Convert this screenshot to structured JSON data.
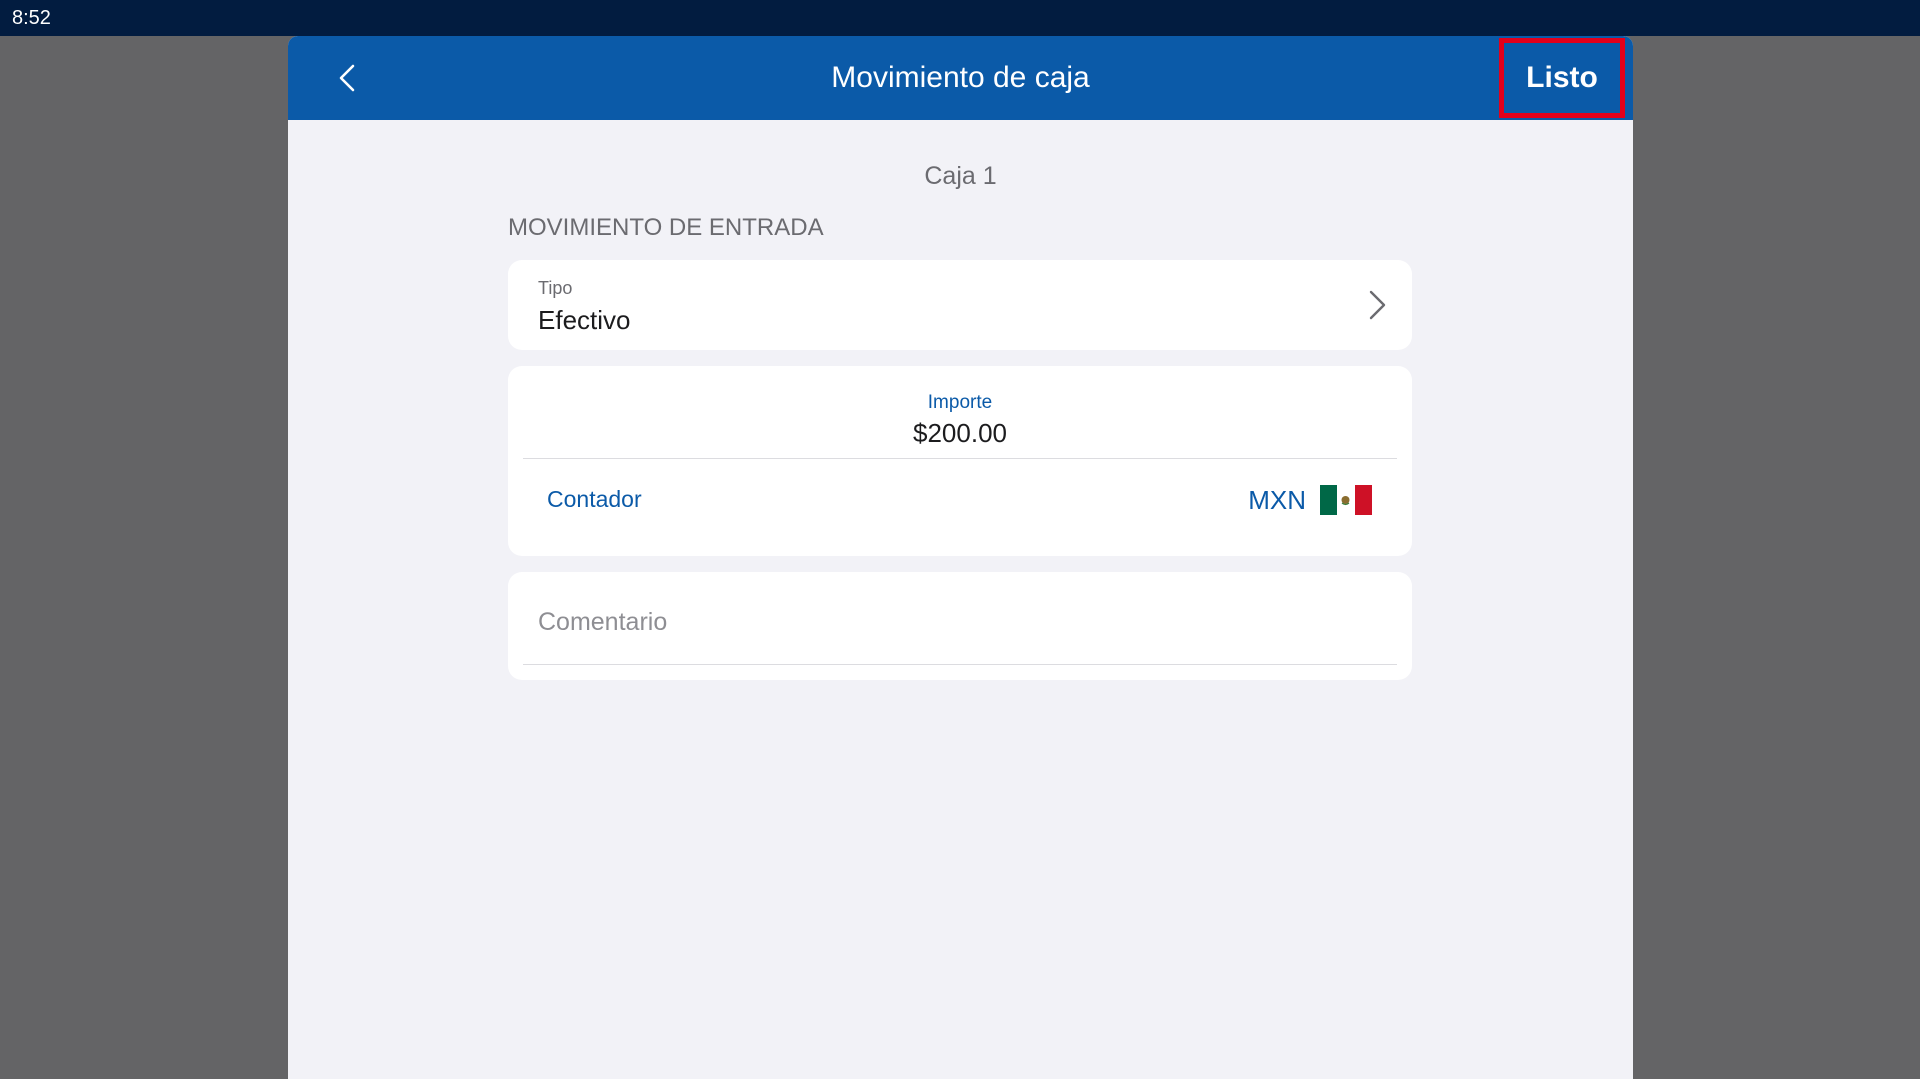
{
  "status_bar": {
    "time": "8:52"
  },
  "nav": {
    "title": "Movimiento de caja",
    "done_label": "Listo"
  },
  "register": {
    "name": "Caja 1"
  },
  "section": {
    "header": "MOVIMIENTO DE ENTRADA"
  },
  "type_field": {
    "label": "Tipo",
    "value": "Efectivo"
  },
  "amount_field": {
    "label": "Importe",
    "value": "$200.00",
    "counter_label": "Contador",
    "currency_code": "MXN"
  },
  "comment_field": {
    "placeholder": "Comentario",
    "value": ""
  },
  "colors": {
    "accent": "#0b5aa8",
    "status_bar": "#021c40",
    "highlight_border": "#e3001b",
    "flag_green": "#006847",
    "flag_white": "#ffffff",
    "flag_red": "#ce1126"
  },
  "icons": {
    "back": "chevron-left-icon",
    "disclosure": "chevron-right-icon",
    "currency_flag": "mexico-flag-icon"
  }
}
